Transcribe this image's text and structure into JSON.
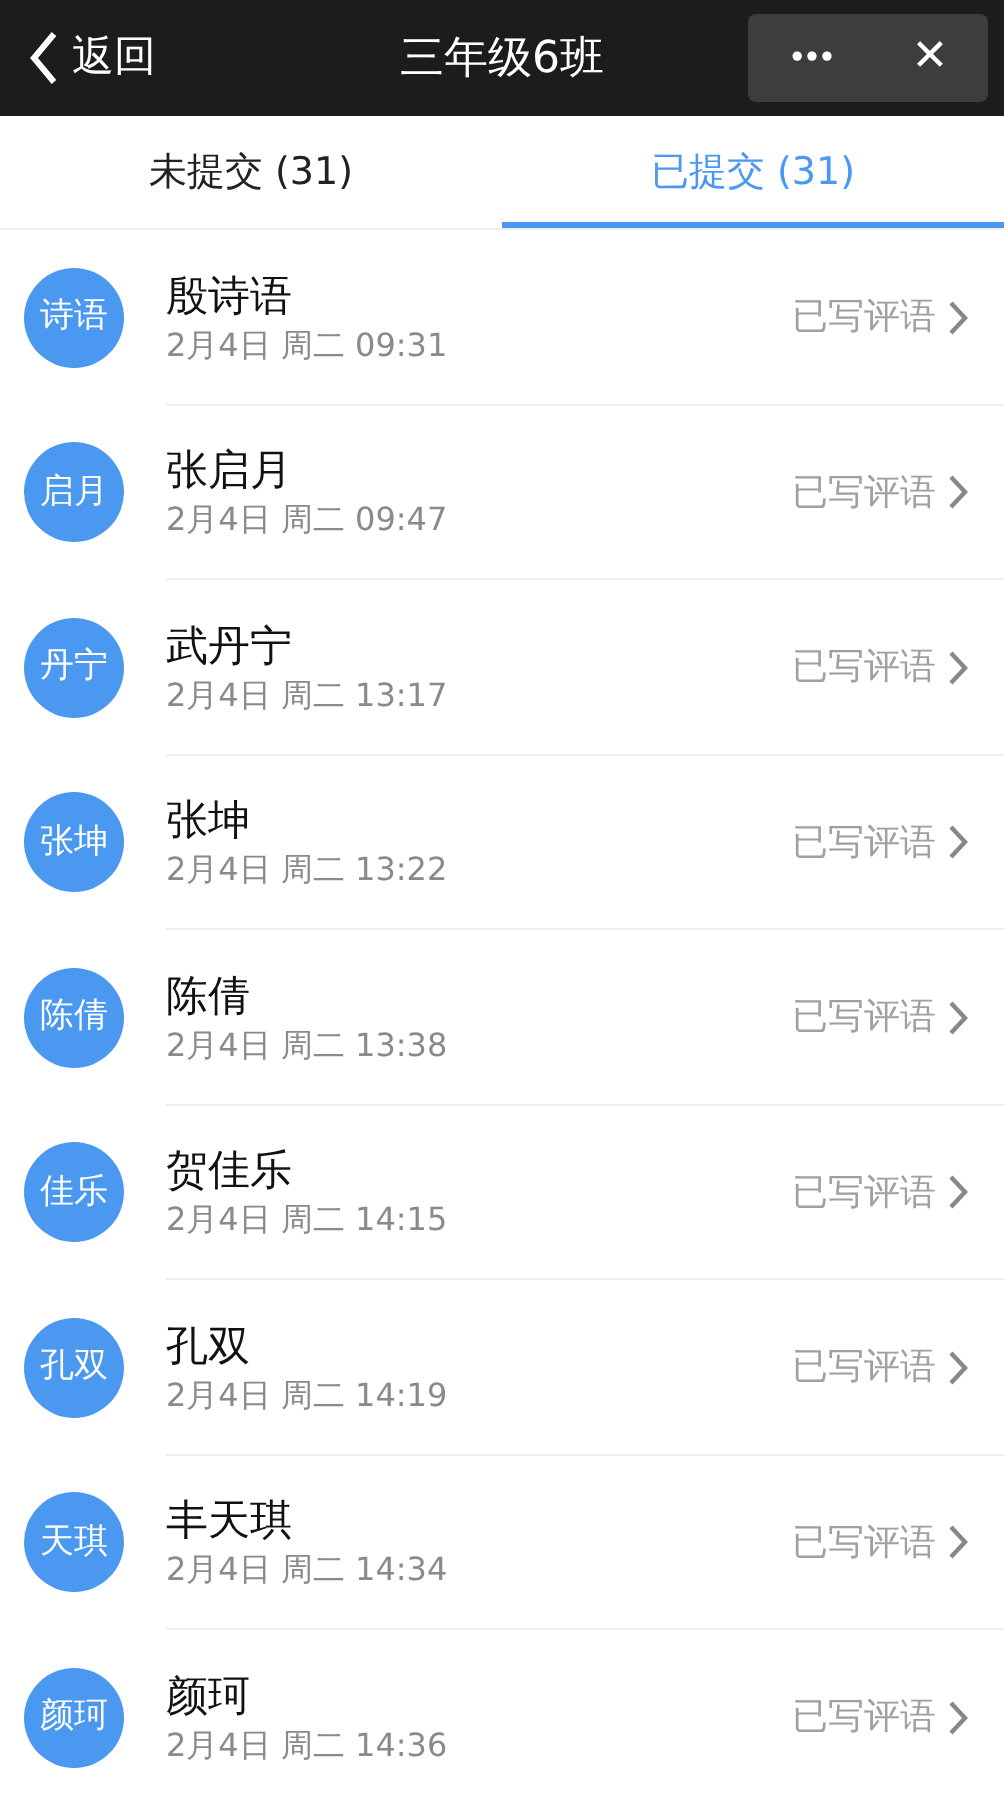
{
  "nav_bar": {
    "back_label": "返回",
    "title": "三年级6班",
    "more_icon": "•••",
    "close_icon": "✕"
  },
  "tabs": [
    {
      "label": "未提交 (31)",
      "selected": false
    },
    {
      "label": "已提交 (31)",
      "selected": true
    }
  ],
  "students": [
    {
      "avatar": "诗语",
      "name": "殷诗语",
      "time": "2月4日 周二 09:31",
      "status": "已写评语"
    },
    {
      "avatar": "启月",
      "name": "张启月",
      "time": "2月4日 周二 09:47",
      "status": "已写评语"
    },
    {
      "avatar": "丹宁",
      "name": "武丹宁",
      "time": "2月4日 周二 13:17",
      "status": "已写评语"
    },
    {
      "avatar": "张坤",
      "name": "张坤",
      "time": "2月4日 周二 13:22",
      "status": "已写评语"
    },
    {
      "avatar": "陈倩",
      "name": "陈倩",
      "time": "2月4日 周二 13:38",
      "status": "已写评语"
    },
    {
      "avatar": "佳乐",
      "name": "贺佳乐",
      "time": "2月4日 周二 14:15",
      "status": "已写评语"
    },
    {
      "avatar": "孔双",
      "name": "孔双",
      "time": "2月4日 周二 14:19",
      "status": "已写评语"
    },
    {
      "avatar": "天琪",
      "name": "丰天琪",
      "time": "2月4日 周二 14:34",
      "status": "已写评语"
    },
    {
      "avatar": "颜珂",
      "name": "颜珂",
      "time": "2月4日 周二 14:36",
      "status": "已写评语"
    }
  ]
}
